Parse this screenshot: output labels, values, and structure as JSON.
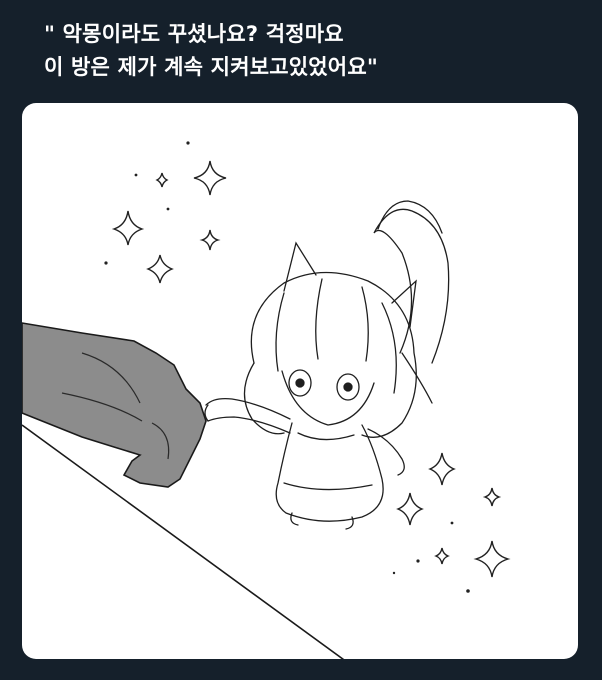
{
  "tweet": {
    "text_line_1": "\" 악몽이라도 꾸셨나요? 걱정마요",
    "text_line_2": "이 방은 제가 계속 지켜보고있었어요\""
  },
  "media": {
    "kind": "illustration",
    "description_icon": "sketch-illustration-icon"
  },
  "colors": {
    "background": "#15202b",
    "text": "#ffffff",
    "card": "#ffffff",
    "hand_fill": "#8c8c8c",
    "line": "#222222"
  }
}
